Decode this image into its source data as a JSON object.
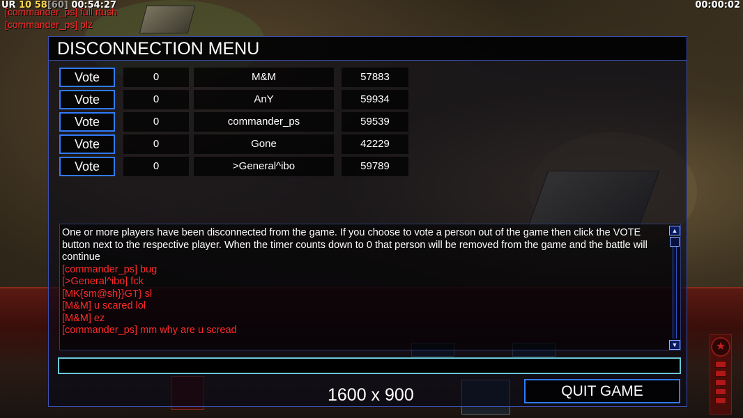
{
  "hud": {
    "ur_label": "UR",
    "stat_a": "10",
    "stat_b": "58",
    "stat_c": "[60]",
    "clock": "00:54:27",
    "timer": "00:00:02"
  },
  "overlay_chat": [
    "[commander_ps] full rtush",
    "[commander_ps] plz"
  ],
  "dialog": {
    "title": "DISCONNECTION MENU",
    "vote_label": "Vote",
    "players": [
      {
        "votes": "0",
        "name": "M&M",
        "ping": "57883"
      },
      {
        "votes": "0",
        "name": "AnY",
        "ping": "59934"
      },
      {
        "votes": "0",
        "name": "commander_ps",
        "ping": "59539"
      },
      {
        "votes": "0",
        "name": "Gone",
        "ping": "42229"
      },
      {
        "votes": "0",
        "name": ">General^ibo",
        "ping": "59789"
      }
    ],
    "system_message": "One or more players have been disconnected from the game. If you choose to vote a person out of the game then click the VOTE button next to the respective player. When the timer counts down to 0 that person will be removed from the game and the battle will continue",
    "chat_messages": [
      "[commander_ps] bug",
      "[>General^ibo] fck",
      "[MK{sm@sh}}GT} sl",
      "[M&M] u scared lol",
      "[M&M] ez",
      "[commander_ps] mm why are u scread"
    ],
    "chat_input_value": "",
    "resolution_label": "1600 x 900",
    "quit_label": "QUIT GAME"
  },
  "colors": {
    "accent_blue": "#2f7bff",
    "chat_red": "#ff2a2a",
    "input_border": "#69c9d9"
  }
}
